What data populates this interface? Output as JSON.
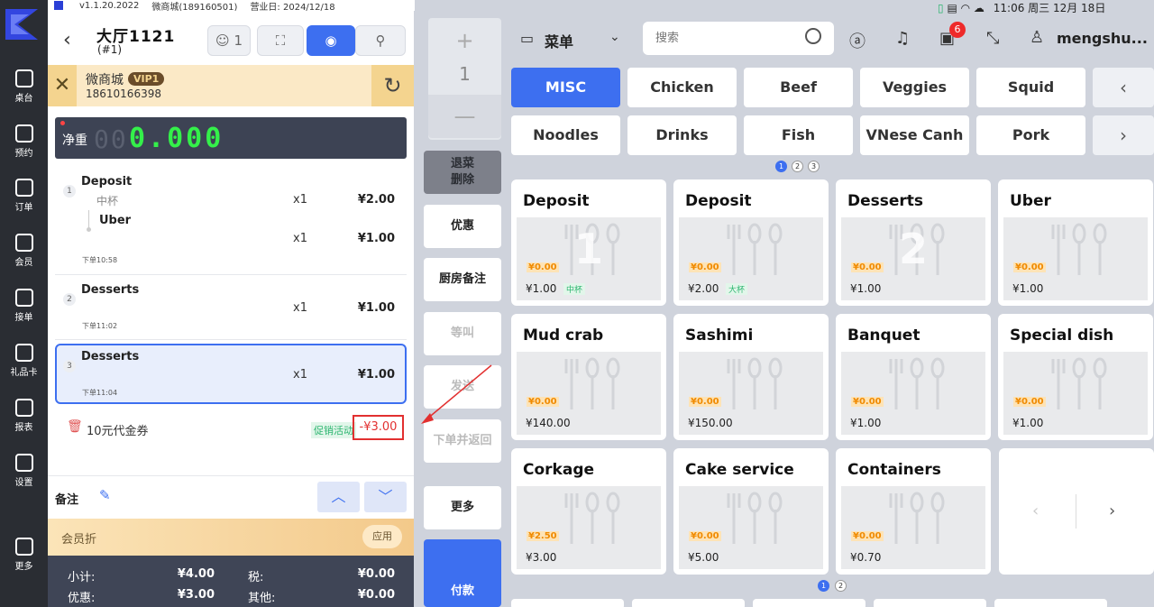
{
  "status_bar": {
    "version": "v1.1.20.2022",
    "shop": "微商城(189160501)",
    "business_day": "营业日: 2024/12/18",
    "time": "11:06 周三 12月 18日"
  },
  "nav": {
    "items": [
      {
        "label": "桌台",
        "icon": "table-icon"
      },
      {
        "label": "预约",
        "icon": "reservation-icon"
      },
      {
        "label": "订单",
        "icon": "order-icon"
      },
      {
        "label": "会员",
        "icon": "member-icon"
      },
      {
        "label": "接单",
        "icon": "accept-order-icon"
      },
      {
        "label": "礼品卡",
        "icon": "gift-card-icon"
      },
      {
        "label": "报表",
        "icon": "report-icon"
      },
      {
        "label": "设置",
        "icon": "settings-icon"
      },
      {
        "label": "更多",
        "icon": "more-icon"
      }
    ]
  },
  "order": {
    "table_name": "大厅1121",
    "table_sub": "(#1)",
    "guests": "1",
    "member": {
      "name": "微商城",
      "level": "VIP1",
      "phone": "18610166398"
    },
    "scale": {
      "label": "净重",
      "ghost": "00",
      "value": "0.000"
    },
    "items": [
      {
        "index": "1",
        "name": "Deposit",
        "spec": "中杯",
        "qty": "x1",
        "price": "¥2.00",
        "sub_name": "Uber",
        "sub_qty": "x1",
        "sub_price": "¥1.00",
        "time": "下单10:58"
      },
      {
        "index": "2",
        "name": "Desserts",
        "qty": "x1",
        "price": "¥1.00",
        "time": "下单11:02"
      },
      {
        "index": "3",
        "name": "Desserts",
        "qty": "x1",
        "price": "¥1.00",
        "time": "下单11:04"
      }
    ],
    "coupon": {
      "label": "10元代金券",
      "tag": "促销活动",
      "amount": "-¥3.00"
    },
    "remark_label": "备注",
    "member_discount": {
      "label": "会员折",
      "apply": "应用"
    },
    "totals": {
      "subtotal_label": "小计:",
      "subtotal": "¥4.00",
      "tax_label": "税:",
      "tax": "¥0.00",
      "discount_label": "优惠:",
      "discount": "¥3.00",
      "other_label": "其他:",
      "other": "¥0.00"
    }
  },
  "actions": {
    "plus": "+",
    "qty": "1",
    "minus": "—",
    "delete": "退菜\n删除",
    "promo": "优惠",
    "kitchen_note": "厨房备注",
    "wait": "等叫",
    "send": "发送",
    "order_return": "下单并返回",
    "more": "更多",
    "pay": "付款"
  },
  "menu": {
    "menu_label": "菜单",
    "search_placeholder": "搜索",
    "user": "mengshu...",
    "notif_count": "6",
    "categories": [
      "MISC",
      "Chicken",
      "Beef",
      "Veggies",
      "Squid",
      "Noodles",
      "Drinks",
      "Fish",
      "VNese Canh",
      "Pork"
    ],
    "category_pages": [
      "1",
      "2",
      "3"
    ],
    "products": [
      {
        "name": "Deposit",
        "tag": "¥0.00",
        "price": "¥1.00",
        "spec": "中杯",
        "num": "1"
      },
      {
        "name": "Deposit",
        "tag": "¥0.00",
        "price": "¥2.00",
        "spec": "大杯",
        "num": ""
      },
      {
        "name": "Desserts",
        "tag": "¥0.00",
        "price": "¥1.00",
        "spec": "",
        "num": "2"
      },
      {
        "name": "Uber",
        "tag": "¥0.00",
        "price": "¥1.00",
        "spec": "",
        "num": ""
      },
      {
        "name": "Mud crab",
        "tag": "¥0.00",
        "price": "¥140.00",
        "spec": "",
        "num": ""
      },
      {
        "name": "Sashimi",
        "tag": "¥0.00",
        "price": "¥150.00",
        "spec": "",
        "num": ""
      },
      {
        "name": "Banquet",
        "tag": "¥0.00",
        "price": "¥1.00",
        "spec": "",
        "num": ""
      },
      {
        "name": "Special dish",
        "tag": "¥0.00",
        "price": "¥1.00",
        "spec": "",
        "num": ""
      },
      {
        "name": "Corkage",
        "tag": "¥2.50",
        "price": "¥3.00",
        "spec": "",
        "num": ""
      },
      {
        "name": "Cake service",
        "tag": "¥0.00",
        "price": "¥5.00",
        "spec": "",
        "num": ""
      },
      {
        "name": "Containers",
        "tag": "¥0.00",
        "price": "¥0.70",
        "spec": "",
        "num": ""
      }
    ],
    "product_pages": [
      "1",
      "2"
    ]
  },
  "colors": {
    "accent": "#3d6ff0",
    "danger": "#e23030",
    "nav_bg": "#2a2d33",
    "member_bg": "#fbe9c6"
  }
}
